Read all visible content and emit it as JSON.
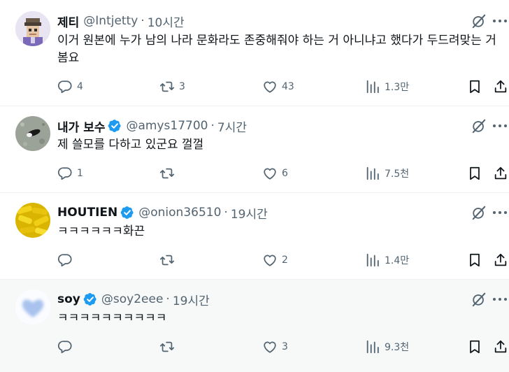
{
  "colors": {
    "text": "#0f1419",
    "secondary": "#536471",
    "verified": "#1d9bf0",
    "divider": "#eff3f4",
    "hover_bg": "#f7f9f9"
  },
  "icons": {
    "grok": "grok-icon",
    "more": "more-icon",
    "reply": "reply-icon",
    "retweet": "retweet-icon",
    "like": "like-icon",
    "views": "views-icon",
    "bookmark": "bookmark-icon",
    "share": "share-icon"
  },
  "tweets": [
    {
      "name": "제티",
      "handle": "@Intjetty",
      "time": "10시간",
      "verified": false,
      "text": "이거 원본에 누가 남의 나라 문화라도 존중해줘야 하는 거 아니냐고 했다가 두드려맞는 거 봄요",
      "replies": "4",
      "retweets": "3",
      "likes": "43",
      "views": "1.3만"
    },
    {
      "name": "내가 보수",
      "handle": "@amys17700",
      "time": "7시간",
      "verified": true,
      "text": "제 쓸모를 다하고 있군요 껄껄",
      "replies": "1",
      "retweets": "",
      "likes": "6",
      "views": "7.5천"
    },
    {
      "name": "HOUTIEN",
      "handle": "@onion36510",
      "time": "19시간",
      "verified": true,
      "text": "ㅋㅋㅋㅋㅋㅋ화끈",
      "replies": "",
      "retweets": "",
      "likes": "2",
      "views": "1.4만"
    },
    {
      "name": "soy",
      "handle": "@soy2eee",
      "time": "19시간",
      "verified": true,
      "text": "ㅋㅋㅋㅋㅋㅋㅋㅋㅋㅋ",
      "replies": "",
      "retweets": "",
      "likes": "3",
      "views": "9.3천"
    }
  ]
}
